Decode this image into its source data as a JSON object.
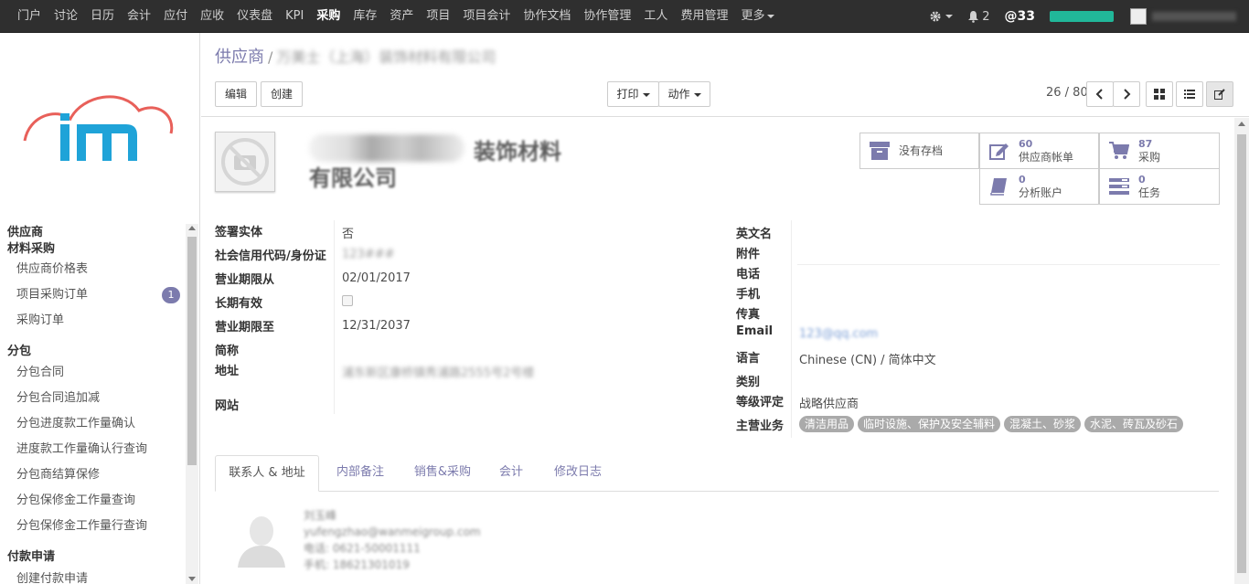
{
  "topbar": {
    "nav": [
      "门户",
      "讨论",
      "日历",
      "会计",
      "应付",
      "应收",
      "仪表盘",
      "KPI",
      "采购",
      "库存",
      "资产",
      "项目",
      "项目会计",
      "协作文档",
      "协作管理",
      "工人",
      "费用管理",
      "更多"
    ],
    "active": "采购",
    "notifications": "2",
    "mentions": "@33"
  },
  "sidebar": {
    "menu": [
      {
        "type": "hdr",
        "label": "供应商"
      },
      {
        "type": "hdr",
        "label": "材料采购"
      },
      {
        "type": "sub",
        "label": "供应商价格表"
      },
      {
        "type": "sub",
        "label": "项目采购订单",
        "badge": "1"
      },
      {
        "type": "sub",
        "label": "采购订单"
      },
      {
        "type": "hdr",
        "label": "分包"
      },
      {
        "type": "sub",
        "label": "分包合同"
      },
      {
        "type": "sub",
        "label": "分包合同追加减"
      },
      {
        "type": "sub",
        "label": "分包进度款工作量确认"
      },
      {
        "type": "sub",
        "label": "进度款工作量确认行查询"
      },
      {
        "type": "sub",
        "label": "分包商结算保修"
      },
      {
        "type": "sub",
        "label": "分包保修金工作量查询"
      },
      {
        "type": "sub",
        "label": "分包保修金工作量行查询"
      },
      {
        "type": "hdr",
        "label": "付款申请"
      },
      {
        "type": "sub",
        "label": "创建付款申请"
      }
    ]
  },
  "control_panel": {
    "breadcrumb_root": "供应商",
    "breadcrumb_current": "万美士（上海）装饰材料有限公司",
    "edit_label": "编辑",
    "create_label": "创建",
    "print_label": "打印",
    "action_label": "动作",
    "pager": "26 / 80"
  },
  "record": {
    "title_line1": "装饰材料",
    "title_line2": "有限公司",
    "stats": {
      "archive": "没有存档",
      "bills_count": "60",
      "bills_label": "供应商帐单",
      "purchase_count": "87",
      "purchase_label": "采购",
      "analytic_count": "0",
      "analytic_label": "分析账户",
      "task_count": "0",
      "task_label": "任务"
    },
    "left_fields": [
      {
        "label": "签署实体",
        "value": "否"
      },
      {
        "label": "社会信用代码/身份证",
        "value": "123###"
      },
      {
        "label": "营业期限从",
        "value": "02/01/2017"
      },
      {
        "label": "长期有效",
        "value": ""
      },
      {
        "label": "营业期限至",
        "value": "12/31/2037"
      },
      {
        "label": "简称",
        "value": ""
      },
      {
        "label": "地址",
        "value": "浦东新区康桥镇秀浦路2555号2号楼"
      },
      {
        "label": "网站",
        "value": ""
      }
    ],
    "right_fields": [
      {
        "label": "英文名",
        "value": ""
      },
      {
        "label": "附件",
        "value": ""
      },
      {
        "label": "电话",
        "value": ""
      },
      {
        "label": "手机",
        "value": ""
      },
      {
        "label": "传真",
        "value": ""
      },
      {
        "label": "Email",
        "value": "123@qq.com"
      },
      {
        "label": "语言",
        "value": "Chinese (CN) / 简体中文"
      },
      {
        "label": "类别",
        "value": ""
      },
      {
        "label": "等级评定",
        "value": "战略供应商"
      },
      {
        "label": "主营业务",
        "value": ""
      }
    ],
    "business_tags": [
      "清洁用品",
      "临时设施、保护及安全辅料",
      "混凝土、砂浆",
      "水泥、砖瓦及砂石"
    ],
    "tabs": [
      "联系人 & 地址",
      "内部备注",
      "销售&采购",
      "会计",
      "修改日志"
    ],
    "contact": {
      "name": "刘玉峰",
      "email": "yufengzhao@wanmeigroup.com",
      "phone": "电话: 0621-50001111",
      "mobile": "手机: 18621301019"
    }
  }
}
